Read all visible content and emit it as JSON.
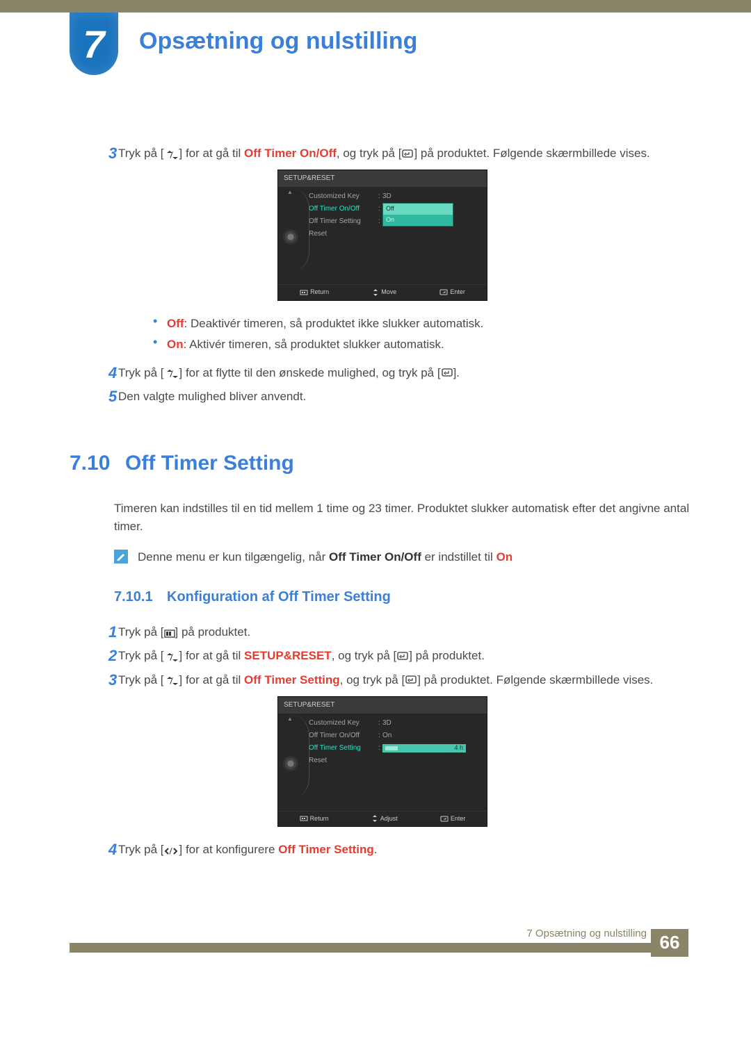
{
  "chapter": {
    "number": "7",
    "title": "Opsætning og nulstilling"
  },
  "top": {
    "step3_num": "3",
    "step3_pre": "Tryk på [",
    "step3_mid1": "] for at gå til ",
    "step3_bold1": "Off Timer On/Off",
    "step3_mid2": ", og tryk på [",
    "step3_mid3": "] på produktet. Følgende skærmbillede vises."
  },
  "osd1": {
    "header": "SETUP&RESET",
    "rows": {
      "customized_key": "Customized Key",
      "customized_key_val": "3D",
      "off_timer_onoff": "Off Timer On/Off",
      "off_timer_setting": "Off Timer Setting",
      "reset": "Reset"
    },
    "dropdown": {
      "off": "Off",
      "on": "On"
    },
    "footer": {
      "return": "Return",
      "move": "Move",
      "enter": "Enter"
    }
  },
  "bullets": {
    "off_label": "Off",
    "off_text": ": Deaktivér timeren, så produktet ikke slukker automatisk.",
    "on_label": "On",
    "on_text": ": Aktivér timeren, så produktet slukker automatisk."
  },
  "step4": {
    "num": "4",
    "pre": "Tryk på [",
    "mid1": "] for at flytte til den ønskede mulighed, og tryk på [",
    "end": "]."
  },
  "step5": {
    "num": "5",
    "text": "Den valgte mulighed bliver anvendt."
  },
  "section": {
    "num": "7.10",
    "title": "Off Timer Setting"
  },
  "section_intro": "Timeren kan indstilles til en tid mellem 1 time og 23 timer. Produktet slukker automatisk efter det angivne antal timer.",
  "note": {
    "pre": "Denne menu er kun tilgængelig, når ",
    "bold": "Off Timer On/Off",
    "mid": " er indstillet til ",
    "on": "On"
  },
  "subsection": {
    "num": "7.10.1",
    "title": "Konfiguration af Off Timer Setting"
  },
  "cfg": {
    "s1": {
      "num": "1",
      "pre": "Tryk på [",
      "end": "] på produktet."
    },
    "s2": {
      "num": "2",
      "pre": "Tryk på [",
      "mid1": "] for at gå til ",
      "bold": "SETUP&RESET",
      "mid2": ", og tryk på [",
      "end": "] på produktet."
    },
    "s3": {
      "num": "3",
      "pre": "Tryk på [",
      "mid1": "] for at gå til ",
      "bold": "Off Timer Setting",
      "mid2": ", og tryk på [",
      "end": "] på produktet. Følgende skærmbillede vises."
    },
    "s4": {
      "num": "4",
      "pre": "Tryk på [",
      "mid1": "] for at konfigurere ",
      "bold": "Off Timer Setting",
      "end": "."
    }
  },
  "osd2": {
    "header": "SETUP&RESET",
    "rows": {
      "customized_key": "Customized Key",
      "customized_key_val": "3D",
      "off_timer_onoff": "Off Timer On/Off",
      "off_timer_onoff_val": "On",
      "off_timer_setting": "Off Timer Setting",
      "reset": "Reset"
    },
    "progress_text": "4 h",
    "footer": {
      "return": "Return",
      "adjust": "Adjust",
      "enter": "Enter"
    }
  },
  "footer": {
    "label": "7 Opsætning og nulstilling",
    "page": "66"
  }
}
